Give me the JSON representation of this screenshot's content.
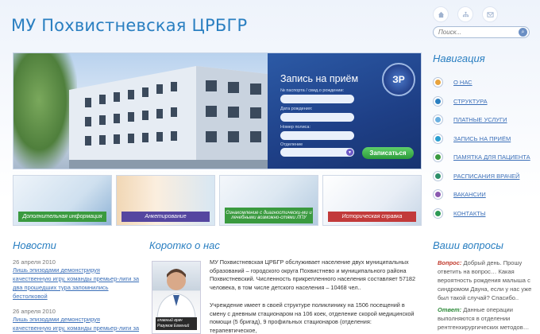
{
  "header": {
    "logo_text": "МУ Похвистневская ЦРБГР",
    "icons": [
      "home-icon",
      "sitemap-icon",
      "mail-icon"
    ],
    "search_placeholder": "Поиск..."
  },
  "appointment_form": {
    "title": "Запись на приём",
    "emblem_text": "ЗР",
    "fields": [
      {
        "label": "№ паспорта / свид.о рождении:",
        "value": ""
      },
      {
        "label": "Дата рождения:",
        "value": ""
      },
      {
        "label": "Номер полиса:",
        "value": ""
      }
    ],
    "select_label": "Отделение",
    "select_value": "",
    "submit_label": "Записаться"
  },
  "tiles": [
    {
      "caption": "Дополнительная информация",
      "color": "#3a9a3f"
    },
    {
      "caption": "Анкетирование",
      "color": "#5546a0"
    },
    {
      "caption": "Ознакомление с диагностически-ми и лечебными возможно-стями ЛПУ",
      "color": "#3a9a3f"
    },
    {
      "caption": "Историческая справка",
      "color": "#c23a3a"
    }
  ],
  "navigation": {
    "title": "Навигация",
    "items": [
      {
        "label": "О НАС",
        "icon": "about-icon",
        "color": "#e8a33d"
      },
      {
        "label": "СТРУКТУРА",
        "icon": "structure-icon",
        "color": "#2a7fc1"
      },
      {
        "label": "ПЛАТНЫЕ УСЛУГИ",
        "icon": "paid-services-icon",
        "color": "#6ab0e0"
      },
      {
        "label": "ЗАПИСЬ НА ПРИЁМ",
        "icon": "appointment-icon",
        "color": "#2a9fd0"
      },
      {
        "label": "ПАМЯТКА ДЛЯ ПАЦИЕНТА",
        "icon": "memo-icon",
        "color": "#3a9a3f"
      },
      {
        "label": "РАСПИСАНИЯ ВРАЧЕЙ",
        "icon": "schedule-icon",
        "color": "#2e8f6a"
      },
      {
        "label": "ВАКАНСИИ",
        "icon": "vacancies-icon",
        "color": "#8a5ab0"
      },
      {
        "label": "КОНТАКТЫ",
        "icon": "contacts-icon",
        "color": "#2e9a55"
      }
    ]
  },
  "news": {
    "title": "Новости",
    "items": [
      {
        "date": "26 апреля 2010",
        "text": "Лишь эпизодами демонстрируя качественную игру, команды премьер-лиги за два прошедших тура запомнились бестолковой"
      },
      {
        "date": "26 апреля 2010",
        "text": "Лишь эпизодами демонстрируя качественную игру, команды премьер-лиги за два"
      }
    ]
  },
  "about": {
    "title": "Коротко о нас",
    "photo_caption": "главный врач Разумов Евгений",
    "paragraphs": [
      "МУ Похвистневская ЦРБГР обслуживает население двух муниципальных образований – городского округа Похвистнево и муниципального района Похвистневский. Численность прикрепленного населения составляет 57182 человека, в том числе детского населения – 10468 чел..",
      "Учреждение имеет в своей структуре поликлинику на 1506 посещений в смену с дневным стационаром на 106 коек, отделение скорой медицинской помощи (5 бригад), 9 профильных стационаров (отделения: терапевтическое,"
    ]
  },
  "questions": {
    "title": "Ваши вопросы",
    "question_label": "Вопрос:",
    "question_text": "Добрый день. Прошу ответить на вопрос… Какая вероятность рождения малыша с синдромом Дауна, если у нас уже был такой случай? Спасибо..",
    "answer_label": "Ответ:",
    "answer_text": "Данные операции выполняются в отделении рентгенхирургических методов…"
  }
}
